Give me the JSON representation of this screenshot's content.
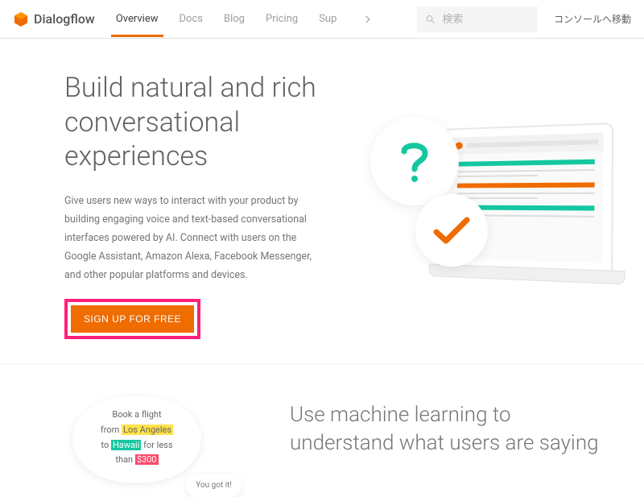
{
  "header": {
    "brand": "Dialogflow",
    "nav": [
      "Overview",
      "Docs",
      "Blog",
      "Pricing",
      "Sup"
    ],
    "search_placeholder": "検索",
    "console_link": "コンソールへ移動"
  },
  "hero": {
    "title": "Build natural and rich conversational experiences",
    "desc": "Give users new ways to interact with your product by building engaging voice and text-based conversational interfaces powered by AI. Connect with users on the Google Assistant, Amazon Alexa, Facebook Messenger, and other popular platforms and devices.",
    "cta": "SIGN UP FOR FREE"
  },
  "section2": {
    "title": "Use machine learning to understand what users are saying",
    "bubble": {
      "line1": "Book a flight",
      "line2_prefix": "from ",
      "line2_hl": "Los Angeles",
      "line3_prefix": "to ",
      "line3_hl": "Hawaii",
      "line3_suffix": " for less",
      "line4_prefix": "than ",
      "line4_hl": "$300",
      "reply": "You got it!"
    }
  },
  "colors": {
    "accent": "#ef6c00",
    "highlight_border": "#ff1f7a",
    "teal": "#14c7a0"
  }
}
